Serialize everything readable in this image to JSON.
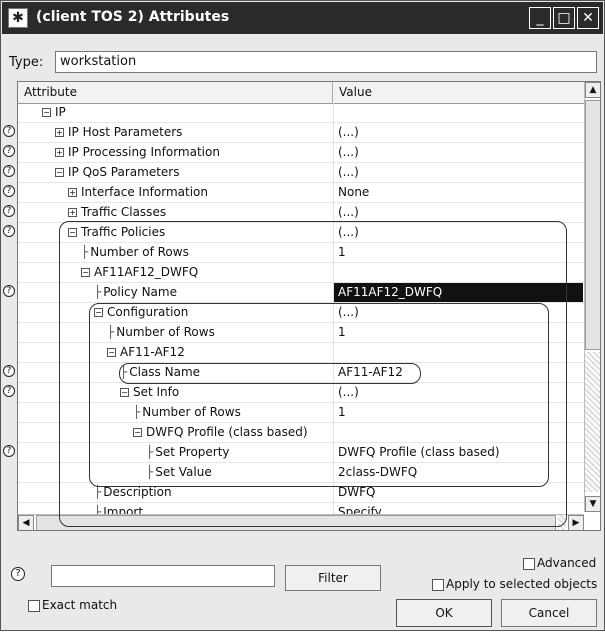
{
  "window": {
    "title": "(client TOS 2) Attributes",
    "icon": "app-star-icon",
    "controls": {
      "minimize": "_",
      "maximize": "□",
      "close": "✕"
    }
  },
  "type_row": {
    "label": "Type:",
    "value": "workstation"
  },
  "grid": {
    "columns": {
      "attribute": "Attribute",
      "value": "Value"
    },
    "rows": [
      {
        "attr": "IP",
        "value": "",
        "help": false,
        "expander": "minus",
        "indent": 0
      },
      {
        "attr": "IP Host Parameters",
        "value": "(...)",
        "help": true,
        "expander": "plus",
        "indent": 1
      },
      {
        "attr": "IP Processing Information",
        "value": "(...)",
        "help": true,
        "expander": "plus",
        "indent": 1
      },
      {
        "attr": "IP QoS Parameters",
        "value": "(...)",
        "help": true,
        "expander": "minus",
        "indent": 1
      },
      {
        "attr": "Interface Information",
        "value": "None",
        "help": true,
        "expander": "plus",
        "indent": 2
      },
      {
        "attr": "Traffic Classes",
        "value": "(...)",
        "help": true,
        "expander": "plus",
        "indent": 2
      },
      {
        "attr": "Traffic Policies",
        "value": "(...)",
        "help": true,
        "expander": "minus",
        "indent": 2
      },
      {
        "attr": "Number of Rows",
        "value": "1",
        "help": false,
        "expander": "leaf",
        "indent": 3
      },
      {
        "attr": "AF11AF12_DWFQ",
        "value": "",
        "help": false,
        "expander": "minus",
        "indent": 3
      },
      {
        "attr": "Policy Name",
        "value": "AF11AF12_DWFQ",
        "help": true,
        "expander": "leaf",
        "indent": 4,
        "selected": true
      },
      {
        "attr": "Configuration",
        "value": "(...)",
        "help": false,
        "expander": "minus",
        "indent": 4
      },
      {
        "attr": "Number of Rows",
        "value": "1",
        "help": false,
        "expander": "leaf",
        "indent": 5
      },
      {
        "attr": "AF11-AF12",
        "value": "",
        "help": false,
        "expander": "minus",
        "indent": 5
      },
      {
        "attr": "Class Name",
        "value": "AF11-AF12",
        "help": true,
        "expander": "leaf",
        "indent": 6
      },
      {
        "attr": "Set Info",
        "value": "(...)",
        "help": true,
        "expander": "minus",
        "indent": 6
      },
      {
        "attr": "Number of Rows",
        "value": "1",
        "help": false,
        "expander": "leaf",
        "indent": 7
      },
      {
        "attr": "DWFQ Profile (class based)",
        "value": "",
        "help": false,
        "expander": "minus",
        "indent": 7
      },
      {
        "attr": "Set Property",
        "value": "DWFQ Profile (class based)",
        "help": true,
        "expander": "leaf",
        "indent": 8
      },
      {
        "attr": "Set Value",
        "value": "2class-DWFQ",
        "help": false,
        "expander": "leaf",
        "indent": 8
      },
      {
        "attr": "Description",
        "value": "DWFQ",
        "help": false,
        "expander": "leaf",
        "indent": 4
      },
      {
        "attr": "Import",
        "value": "Specify...",
        "help": false,
        "expander": "leaf",
        "indent": 4
      }
    ]
  },
  "bottom": {
    "filter_button": "Filter",
    "advanced_label": "Advanced",
    "apply_label": "Apply to selected objects",
    "exact_match_label": "Exact match",
    "ok_label": "OK",
    "cancel_label": "Cancel"
  }
}
